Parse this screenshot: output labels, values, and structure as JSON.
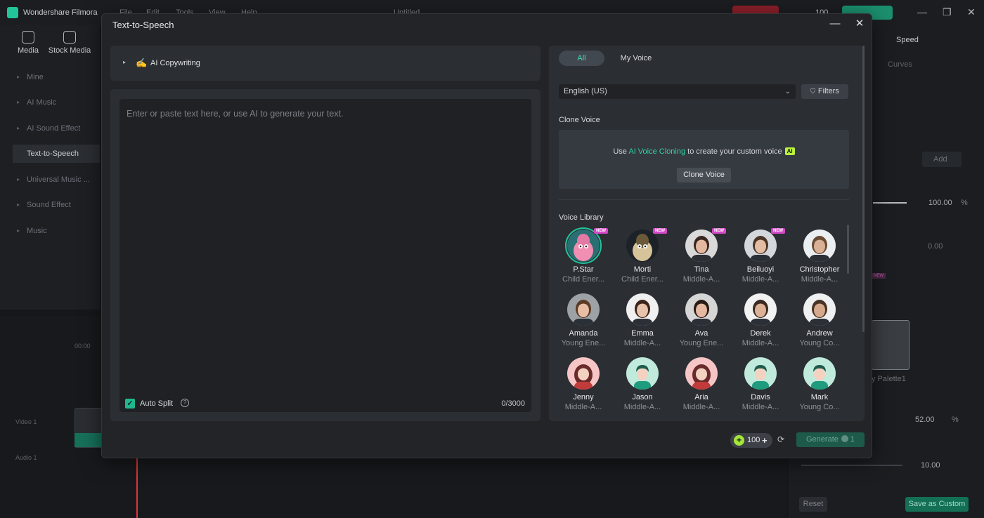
{
  "app": {
    "name": "Wondershare Filmora",
    "menu": [
      "File",
      "Edit",
      "Tools",
      "View",
      "Help"
    ],
    "project_title": "Untitled",
    "credits_top": "100"
  },
  "left_panel": {
    "tabs": [
      {
        "label": "Media",
        "icon": "media-icon"
      },
      {
        "label": "Stock Media",
        "icon": "stock-media-icon"
      }
    ],
    "items": [
      "Mine",
      "AI Music",
      "AI Sound Effect",
      "Text-to-Speech",
      "Universal Music ...",
      "Sound Effect",
      "Music"
    ],
    "active_item": "Text-to-Speech"
  },
  "timeline": {
    "time": "00:00",
    "video_track": "Video 1",
    "audio_track": "Audio 1"
  },
  "right_panel": {
    "tab": "Speed",
    "curves": "Curves",
    "add_label": "Add",
    "value1": "100.00",
    "unit1": "%",
    "value2": "0.00",
    "palette_label": "y Palette1",
    "new_badge": "NEW",
    "value3": "52.00",
    "unit3": "%",
    "value4": "10.00",
    "reset_label": "Reset",
    "save_custom_label": "Save as Custom"
  },
  "dialog": {
    "title": "Text-to-Speech",
    "ai_copywriting": "AI Copywriting",
    "editor_placeholder": "Enter or paste text here, or use AI to generate your text.",
    "auto_split": "Auto Split",
    "auto_split_checked": true,
    "char_count": "0/3000",
    "tabs": {
      "all": "All",
      "my_voice": "My Voice"
    },
    "language": "English (US)",
    "filters": "Filters",
    "clone_voice_title": "Clone Voice",
    "clone_text_pre": "Use ",
    "clone_text_link": "AI Voice Cloning",
    "clone_text_post": " to create your custom voice",
    "ai_badge": "AI",
    "clone_button": "Clone Voice",
    "voice_library_title": "Voice Library",
    "credits": "100",
    "generate": "Generate",
    "generate_cost": "1",
    "accent_color": "#22c59a"
  },
  "voices": [
    {
      "name": "P.Star",
      "desc": "Child Ener...",
      "is_new": true,
      "selected": true,
      "bg": "#2a6f73",
      "skin": "#f08fb1",
      "hair": "#e27aa3",
      "style": "character"
    },
    {
      "name": "Morti",
      "desc": "Child Ener...",
      "is_new": true,
      "selected": false,
      "bg": "#1c2228",
      "skin": "#d7c39a",
      "hair": "#6b5a3a",
      "style": "character"
    },
    {
      "name": "Tina",
      "desc": "Middle-A...",
      "is_new": true,
      "selected": false,
      "bg": "#d9d9d9",
      "skin": "#e2b9a0",
      "hair": "#3a2620",
      "style": "photo"
    },
    {
      "name": "Beiluoyi",
      "desc": "Middle-A...",
      "is_new": true,
      "selected": false,
      "bg": "#d4d8dc",
      "skin": "#e2bda3",
      "hair": "#4a3426",
      "style": "photo"
    },
    {
      "name": "Christopher",
      "desc": "Middle-A...",
      "is_new": false,
      "selected": false,
      "bg": "#eceff1",
      "skin": "#d9b096",
      "hair": "#6a4a32",
      "style": "photo"
    },
    {
      "name": "Amanda",
      "desc": "Young Ene...",
      "is_new": false,
      "selected": false,
      "bg": "#9da2a6",
      "skin": "#e6bfa6",
      "hair": "#5b3a26",
      "style": "photo"
    },
    {
      "name": "Emma",
      "desc": "Middle-A...",
      "is_new": false,
      "selected": false,
      "bg": "#f0f0f0",
      "skin": "#e7c3ab",
      "hair": "#3b2419",
      "style": "photo"
    },
    {
      "name": "Ava",
      "desc": "Young Ene...",
      "is_new": false,
      "selected": false,
      "bg": "#d6d6d6",
      "skin": "#e5b9a1",
      "hair": "#2b1b15",
      "style": "photo"
    },
    {
      "name": "Derek",
      "desc": "Middle-A...",
      "is_new": false,
      "selected": false,
      "bg": "#f2f2f2",
      "skin": "#dcb195",
      "hair": "#3a2a20",
      "style": "photo"
    },
    {
      "name": "Andrew",
      "desc": "Young Co...",
      "is_new": false,
      "selected": false,
      "bg": "#eef0f2",
      "skin": "#d6a98c",
      "hair": "#4a3324",
      "style": "photo"
    },
    {
      "name": "Jenny",
      "desc": "Middle-A...",
      "is_new": false,
      "selected": false,
      "bg": "#f6c6c6",
      "skin": "#f3d2c1",
      "hair": "#6a2a2a",
      "style": "flat-f"
    },
    {
      "name": "Jason",
      "desc": "Middle-A...",
      "is_new": false,
      "selected": false,
      "bg": "#bfeadc",
      "skin": "#f3d2c1",
      "hair": "#1f5a4c",
      "style": "flat-m"
    },
    {
      "name": "Aria",
      "desc": "Middle-A...",
      "is_new": false,
      "selected": false,
      "bg": "#f6c6c6",
      "skin": "#f3d2c1",
      "hair": "#6a2a2a",
      "style": "flat-f"
    },
    {
      "name": "Davis",
      "desc": "Middle-A...",
      "is_new": false,
      "selected": false,
      "bg": "#bfeadc",
      "skin": "#f3d2c1",
      "hair": "#1f5a4c",
      "style": "flat-m"
    },
    {
      "name": "Mark",
      "desc": "Young Co...",
      "is_new": false,
      "selected": false,
      "bg": "#bfeadc",
      "skin": "#f3d2c1",
      "hair": "#1f5a4c",
      "style": "flat-m"
    }
  ]
}
